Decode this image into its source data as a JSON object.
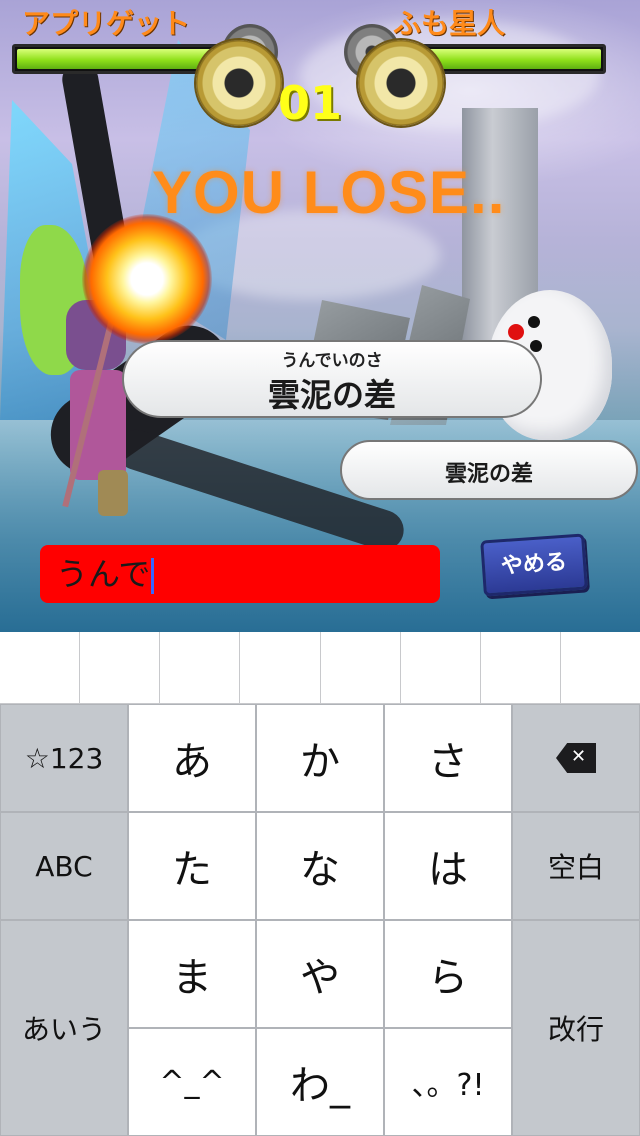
{
  "hud": {
    "player1_name": "アプリゲット",
    "player2_name": "ふも星人",
    "round": "01",
    "player1_hp": 1.0,
    "player2_hp": 1.0
  },
  "result": "YOU LOSE..",
  "word_main": {
    "ruby": "うんでいのさ",
    "text": "雲泥の差"
  },
  "word_sub": {
    "text": "雲泥の差"
  },
  "answer": {
    "value": "うんで"
  },
  "quit_label": "やめる",
  "keyboard": {
    "left": {
      "symbols": "☆123",
      "abc": "ABC",
      "hiragana": "あいう"
    },
    "rows": [
      [
        "あ",
        "か",
        "さ"
      ],
      [
        "た",
        "な",
        "は"
      ],
      [
        "ま",
        "や",
        "ら"
      ],
      [
        "^_^",
        "わ_",
        "、。?!"
      ]
    ],
    "right": {
      "space": "空白",
      "enter": "改行"
    }
  },
  "colors": {
    "name": "#ff8a1a",
    "round": "#ffff19",
    "result": "#ff8c1a",
    "input_bg": "#ff0000",
    "quit_bg": "#3b4db5"
  }
}
